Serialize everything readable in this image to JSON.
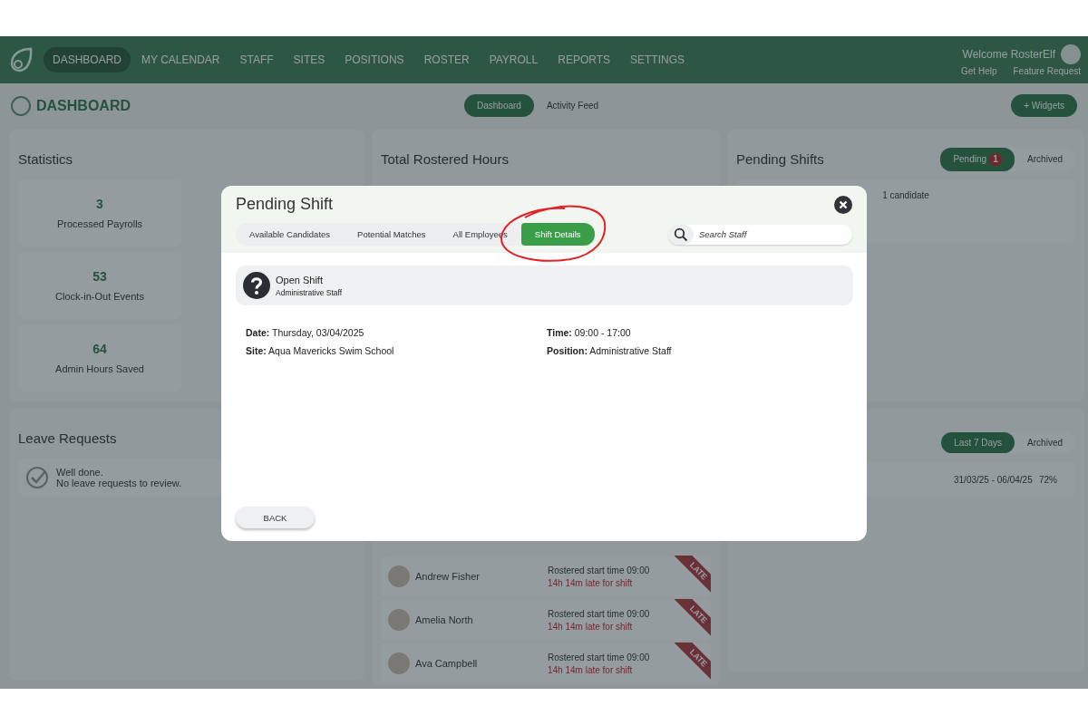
{
  "nav": {
    "items": [
      {
        "label": "DASHBOARD",
        "selected": true
      },
      {
        "label": "MY CALENDAR",
        "selected": false
      },
      {
        "label": "STAFF",
        "selected": false
      },
      {
        "label": "SITES",
        "selected": false
      },
      {
        "label": "POSITIONS",
        "selected": false
      },
      {
        "label": "ROSTER",
        "selected": false
      },
      {
        "label": "PAYROLL",
        "selected": false
      },
      {
        "label": "REPORTS",
        "selected": false
      },
      {
        "label": "SETTINGS",
        "selected": false
      }
    ],
    "welcome": "Welcome RosterElf",
    "links": [
      "Get Help",
      "Feature Request"
    ]
  },
  "dashboard": {
    "title": "DASHBOARD",
    "view_tabs": [
      {
        "label": "Dashboard",
        "selected": true
      },
      {
        "label": "Activity Feed",
        "selected": false
      }
    ],
    "widgets_button": "+ Widgets"
  },
  "statistics": {
    "title": "Statistics",
    "stats": [
      {
        "value": "3",
        "label": "Processed Payrolls"
      },
      {
        "value": "53",
        "label": "Clock-in-Out Events"
      },
      {
        "value": "64",
        "label": "Admin Hours Saved"
      }
    ]
  },
  "leave_requests": {
    "title": "Leave Requests",
    "message": [
      "Well done.",
      "No leave requests to review."
    ]
  },
  "total_rostered_hours": {
    "title": "Total Rostered Hours"
  },
  "clock_ins": [
    {
      "name": "Andrew Fisher",
      "rostered": "Rostered start time 09:00",
      "late": "14h 14m late for shift",
      "ribbon": "LATE"
    },
    {
      "name": "Amelia North",
      "rostered": "Rostered start time 09:00",
      "late": "14h 14m late for shift",
      "ribbon": "LATE"
    },
    {
      "name": "Ava Campbell",
      "rostered": "Rostered start time 09:00",
      "late": "14h 14m late for shift",
      "ribbon": "LATE"
    }
  ],
  "pending_shifts": {
    "title": "Pending Shifts",
    "tabs": [
      {
        "label": "Pending",
        "selected": true,
        "badge": "1"
      },
      {
        "label": "Archived",
        "selected": false
      }
    ],
    "candidates": "1 candidate"
  },
  "timesheets": {
    "tabs": [
      {
        "label": "Last 7 Days",
        "selected": true
      },
      {
        "label": "Archived",
        "selected": false
      }
    ],
    "row": {
      "period": "31/03/25 - 06/04/25",
      "percent": "72%"
    }
  },
  "modal": {
    "title": "Pending Shift",
    "tabs": [
      {
        "label": "Available Candidates",
        "selected": false,
        "circled": false
      },
      {
        "label": "Potential Matches",
        "selected": false,
        "circled": false
      },
      {
        "label": "All Employees",
        "selected": false,
        "circled": false
      },
      {
        "label": "Shift Details",
        "selected": true,
        "circled": true
      }
    ],
    "search": {
      "placeholder": "Search Staff"
    },
    "shift": {
      "title": "Open Shift",
      "subtitle": "Administrative Staff"
    },
    "details": [
      {
        "label": "Date:",
        "value": "Thursday, 03/04/2025"
      },
      {
        "label": "Time:",
        "value": "09:00 - 17:00"
      },
      {
        "label": "Site:",
        "value": "Aqua Mavericks Swim School"
      },
      {
        "label": "Position:",
        "value": "Administrative Staff"
      }
    ],
    "back_button": "BACK"
  }
}
